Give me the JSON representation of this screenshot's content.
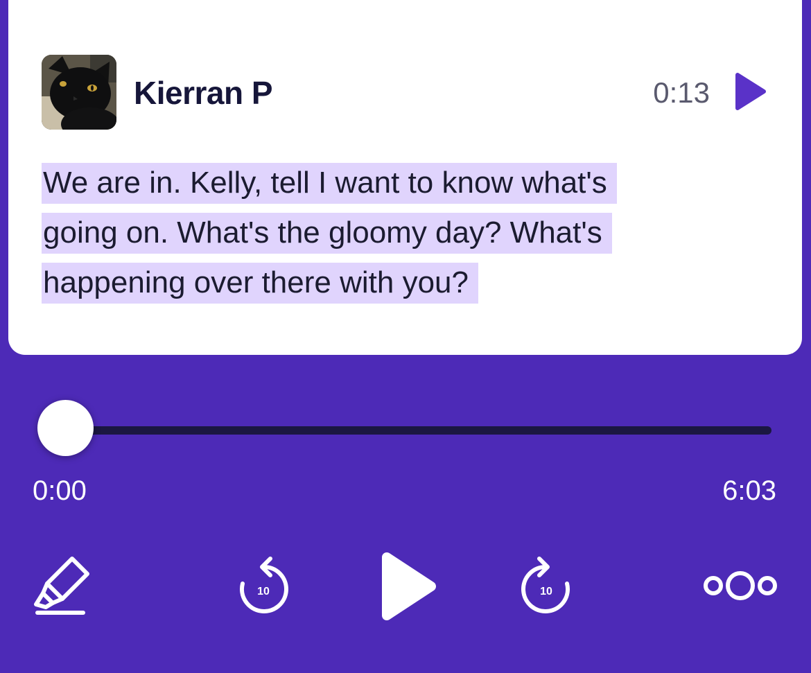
{
  "snippet": {
    "speaker": "Kierran P",
    "timestamp": "0:13",
    "transcript_lines": [
      "We are in. Kelly, tell I want to know what's",
      "going on. What's the gloomy day? What's",
      "happening over there with you?"
    ]
  },
  "player": {
    "current_time": "0:00",
    "total_time": "6:03",
    "progress": 0,
    "skip_back_label": "10",
    "skip_forward_label": "10"
  },
  "colors": {
    "background": "#4d2ab7",
    "accent": "#5a32c8",
    "highlight": "#e0d4fd",
    "track": "#1b1742"
  },
  "icons": {
    "avatar": "black-cat-photo",
    "snippet_play": "play-icon",
    "highlight": "highlighter-icon",
    "skip_back": "rewind-10-icon",
    "play": "play-icon",
    "skip_forward": "forward-10-icon",
    "more": "more-options-icon"
  }
}
